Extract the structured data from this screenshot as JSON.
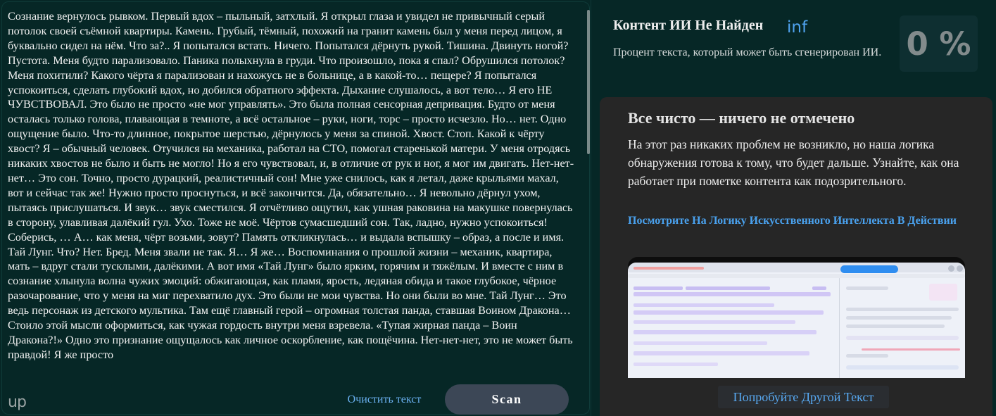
{
  "editor": {
    "text": "Сознание вернулось рывком. Первый вдох – пыльный, затхлый. Я открыл глаза и увидел не привычный серый потолок своей съёмной квартиры. Камень. Грубый, тёмный, похожий на гранит камень был у меня перед лицом, я буквально сидел на нём. Что за?.. Я попытался встать. Ничего. Попытался дёрнуть рукой. Тишина. Двинуть ногой? Пустота. Меня будто парализовало. Паника полыхнула в груди. Что произошло, пока я спал? Обрушился потолок? Меня похитили? Какого чёрта я парализован и нахожусь не в больнице, а в какой-то… пещере? Я попытался успокоиться, сделать глубокий вдох, но добился обратного эффекта. Дыхание слушалось, а вот тело… Я его НЕ ЧУВСТВОВАЛ. Это было не просто «не мог управлять». Это была полная сенсорная депривация. Будто от меня осталась только голова, плавающая в темноте, а всё остальное – руки, ноги, торс – просто исчезло. Но… нет. Одно ощущение было. Что-то длинное, покрытое шерстью, дёрнулось у меня за спиной. Хвост. Стоп. Какой к чёрту хвост? Я – обычный человек. Отучился на механика, работал на СТО, помогал старенькой матери. У меня отродясь никаких хвостов не было и быть не могло! Но я его чувствовал, и, в отличие от рук и ног, я мог им двигать. Нет-нет-нет… Это сон. Точно, просто дурацкий, реалистичный сон! Мне уже снилось, как я летал, даже крыльями махал, вот и сейчас так же! Нужно просто проснуться, и всё закончится. Да, обязательно… Я невольно дёрнул ухом, пытаясь прислушаться. И звук… звук сместился. Я отчётливо ощутил, как ушная раковина на макушке повернулась в сторону, улавливая далёкий гул. Ухо. Тоже не моё. Чёртов сумасшедший сон. Так, ладно, нужно успокоиться! Соберись, … А… как меня, чёрт возьми, зовут? Память откликнулась… и выдала вспышку – образ, а после и имя. Тай Лунг. Что? Нет. Бред. Меня звали не так. Я… Я же… Воспоминания о прошлой жизни – механик, квартира, мать – вдруг стали тусклыми, далёкими. А вот имя «Тай Лунг» было ярким, горячим и тяжёлым. И вместе с ним в сознание хлынула волна чужих эмоций: обжигающая, как пламя, ярость, ледяная обида и такое глубокое, чёрное разочарование, что у меня на миг перехватило дух. Это были не мои чувства. Но они были во мне. Тай Лунг… Это ведь персонаж из детского мультика. Там ещё главный герой – огромная толстая панда, ставшая Воином Дракона… Стоило этой мысли оформиться, как чужая гордость внутри меня взревела. «Тупая жирная панда – Воин Дракона?!» Одно это признание ощущалось как личное оскорбление, как пощёчина. Нет-нет-нет, это не может быть правдой! Я же просто"
  },
  "footer": {
    "brand": "up",
    "clear_label": "Очистить текст",
    "scan_label": "Scan"
  },
  "result": {
    "title": "Контент ИИ Не Найден",
    "score_text": "inf",
    "description": "Процент текста, который может быть сгенерирован ИИ.",
    "percent": "0 %"
  },
  "info": {
    "title": "Все чисто — ничего не отмечено",
    "body": "На этот раз никаких проблем не возникло, но наша логика обнаружения готова к тому, что будет дальше. Узнайте, как она работает при пометке контента как подозрительного.",
    "link": "Посмотрите На Логику Искусственного Интеллекта В Действии",
    "try_label": "Попробуйте Другой Текст"
  },
  "colors": {
    "background": "#062726",
    "accent_link": "#4aa2ef",
    "scan_button": "#3c4756",
    "card": "#262626"
  }
}
